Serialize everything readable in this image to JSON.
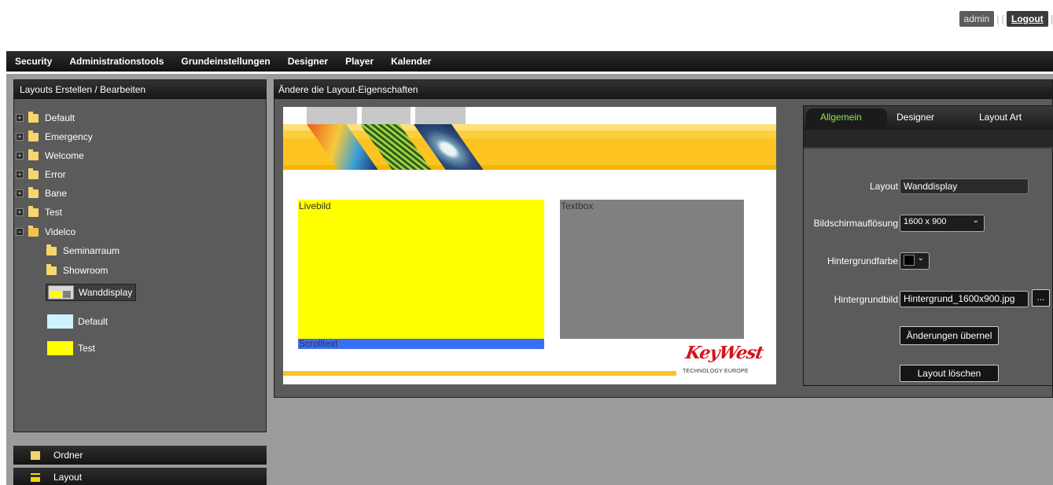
{
  "user": {
    "name": "admin",
    "separator_left": "| [",
    "logout_label": "Logout",
    "separator_right": "]"
  },
  "nav": [
    "Security",
    "Administrationstools",
    "Grundeinstellungen",
    "Designer",
    "Player",
    "Kalender"
  ],
  "left_panel": {
    "title": "Layouts Erstellen / Bearbeiten",
    "tree": [
      {
        "label": "Default",
        "expander": "+"
      },
      {
        "label": "Emergency",
        "expander": "+"
      },
      {
        "label": "Welcome",
        "expander": "+"
      },
      {
        "label": "Error",
        "expander": "+"
      },
      {
        "label": "Bane",
        "expander": "+"
      },
      {
        "label": "Test",
        "expander": "+"
      },
      {
        "label": "Videlco",
        "expander": "−"
      }
    ],
    "children": [
      "Seminarraum",
      "Showroom"
    ],
    "layouts": [
      "Wanddisplay",
      "Default",
      "Test"
    ]
  },
  "accordion": {
    "ordner": "Ordner",
    "layout": "Layout"
  },
  "right_panel": {
    "title": "Ändere die Layout-Eigenschaften"
  },
  "preview": {
    "zones": {
      "live": "Livebild",
      "text": "Textbox",
      "scroll": "Scrolltext"
    },
    "logo": {
      "word": "KeyWest",
      "sub": "TECHNOLOGY EUROPE"
    },
    "colors": {
      "live": "#ffff00",
      "text": "#808080",
      "scroll": "#3a6ef5"
    }
  },
  "properties": {
    "tabs": {
      "allgemein": "Allgemein",
      "designer": "Designer",
      "layout_art": "Layout Art"
    },
    "layout_label": "Layout",
    "layout_value": "Wanddisplay",
    "resolution_label": "Bildschirmauflösung",
    "resolution_value": "1600 x 900",
    "bgcolor_label": "Hintergrundfarbe",
    "bgcolor_value": "#000000",
    "bgimage_label": "Hintergrundbild",
    "bgimage_value": "Hintergrund_1600x900.jpg",
    "browse_label": "...",
    "apply_label": "Änderungen übernel",
    "delete_label": "Layout löschen",
    "accent": "#8ee84a"
  }
}
